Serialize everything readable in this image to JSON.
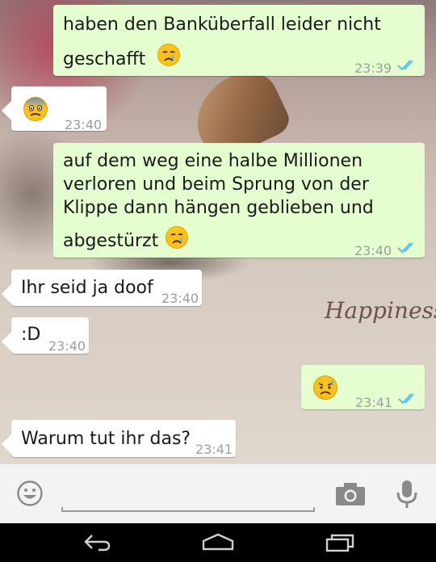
{
  "messages": [
    {
      "id": "m1",
      "direction": "out",
      "lines": [
        "haben den Banküberfall leider nicht",
        "geschafft"
      ],
      "emoji": "crying-face",
      "time": "23:39",
      "status": "read"
    },
    {
      "id": "m2",
      "direction": "in",
      "lines": [],
      "emoji": "fearful-face",
      "time": "23:40"
    },
    {
      "id": "m3",
      "direction": "out",
      "lines": [
        "auf dem weg eine halbe Millionen",
        "verloren und beim Sprung von der",
        "Klippe dann hängen geblieben und",
        "abgestürzt"
      ],
      "emoji": "crying-face",
      "time": "23:40",
      "status": "read"
    },
    {
      "id": "m4",
      "direction": "in",
      "lines": [
        "Ihr seid ja doof"
      ],
      "time": "23:40"
    },
    {
      "id": "m5",
      "direction": "in",
      "lines": [
        ":D"
      ],
      "time": "23:40"
    },
    {
      "id": "m6",
      "direction": "out",
      "lines": [],
      "emoji": "disappointed-relieved-face",
      "time": "23:41",
      "status": "read"
    },
    {
      "id": "m7",
      "direction": "in",
      "lines": [
        "Warum tut ihr das?"
      ],
      "time": "23:41"
    }
  ],
  "wallpaper": {
    "script_text": "Happiness"
  },
  "input_bar": {
    "icons": [
      "smiley-icon",
      "camera-icon",
      "microphone-icon"
    ]
  },
  "navbar": {
    "icons": [
      "back-icon",
      "home-icon",
      "recent-apps-icon"
    ]
  },
  "colors": {
    "outgoing_bubble": "#e4fecf",
    "incoming_bubble": "#ffffff",
    "read_ticks": "#4fc3f7",
    "time_text": "#9aa39a"
  }
}
